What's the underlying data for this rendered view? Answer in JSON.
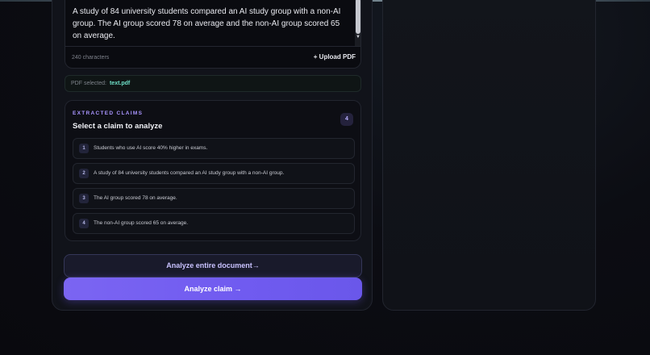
{
  "input": {
    "text": "A study of 84 university students compared an AI study group with a non-AI group. The AI group scored 78 on average and the non-AI group scored 65 on average.",
    "char_count": "240 characters",
    "upload_label": "+ Upload PDF"
  },
  "pdf": {
    "label": "PDF selected:",
    "filename": "text.pdf"
  },
  "claims": {
    "kicker": "EXTRACTED CLAIMS",
    "title": "Select a claim to analyze",
    "count": "4",
    "items": [
      {
        "num": "1",
        "text": "Students who use AI score 40% higher in exams."
      },
      {
        "num": "2",
        "text": "A study of 84 university students compared an AI study group with a non-AI group."
      },
      {
        "num": "3",
        "text": "The AI group scored 78 on average."
      },
      {
        "num": "4",
        "text": "The non-AI group scored 65 on average."
      }
    ]
  },
  "actions": {
    "analyze_document": "Analyze entire document→",
    "analyze_claim": "Analyze claim  →"
  },
  "colors": {
    "accent": "#705bf0",
    "kicker": "#a995ff",
    "filename": "#6fe0c8"
  }
}
